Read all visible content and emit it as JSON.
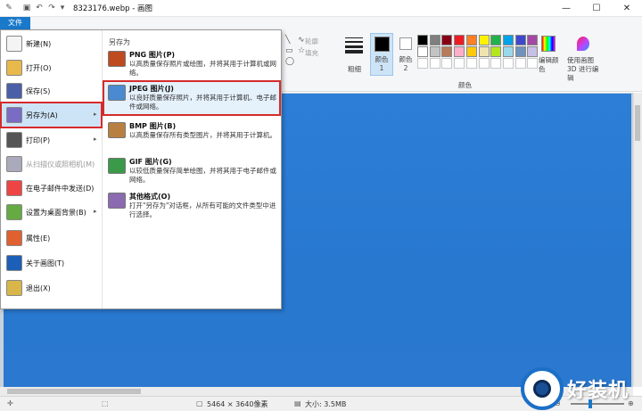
{
  "window": {
    "title": "8323176.webp - 画图",
    "controls": {
      "minimize": "—",
      "maximize": "☐",
      "close": "✕"
    }
  },
  "quick_access": [
    "save-icon",
    "undo-icon",
    "redo-icon",
    "customize-icon"
  ],
  "ribbon": {
    "file_tab": "文件",
    "shapes": {
      "outline": "轮廓",
      "fill": "填充"
    },
    "size_label": "粗细",
    "color1_label": "颜色 1",
    "color2_label": "颜色 2",
    "colors_group": "颜色",
    "edit_colors": "编辑颜色",
    "paint3d": "使用画图 3D 进行编辑",
    "palette_row1": [
      "#000000",
      "#7f7f7f",
      "#880015",
      "#ed1c24",
      "#ff7f27",
      "#fff200",
      "#22b14c",
      "#00a2e8",
      "#3f48cc",
      "#a349a4"
    ],
    "palette_row2": [
      "#ffffff",
      "#c3c3c3",
      "#b97a57",
      "#ffaec9",
      "#ffc90e",
      "#efe4b0",
      "#b5e61d",
      "#99d9ea",
      "#7092be",
      "#c8bfe7"
    ]
  },
  "file_menu": {
    "items": [
      {
        "label": "新建(N)",
        "icon": "new-icon"
      },
      {
        "label": "打开(O)",
        "icon": "open-icon"
      },
      {
        "label": "保存(S)",
        "icon": "save-icon"
      },
      {
        "label": "另存为(A)",
        "icon": "save-as-icon",
        "has_arrow": true,
        "selected": true
      },
      {
        "label": "打印(P)",
        "icon": "print-icon",
        "has_arrow": true
      },
      {
        "label": "从扫描仪或照相机(M)",
        "icon": "scanner-icon",
        "disabled": true
      },
      {
        "label": "在电子邮件中发送(D)",
        "icon": "email-icon"
      },
      {
        "label": "设置为桌面背景(B)",
        "icon": "desktop-icon",
        "has_arrow": true
      },
      {
        "label": "属性(E)",
        "icon": "properties-icon"
      },
      {
        "label": "关于画图(T)",
        "icon": "info-icon"
      },
      {
        "label": "退出(X)",
        "icon": "exit-icon"
      }
    ],
    "submenu_title": "另存为",
    "save_options": [
      {
        "title": "PNG 图片(P)",
        "desc": "以高质量保存照片或绘图，并将其用于计算机或网络。",
        "icon": "png-icon"
      },
      {
        "title": "JPEG 图片(J)",
        "desc": "以良好质量保存照片，并将其用于计算机、电子邮件或网络。",
        "icon": "jpeg-icon",
        "highlight": true
      },
      {
        "title": "BMP 图片(B)",
        "desc": "以高质量保存所有类型图片，并将其用于计算机。",
        "icon": "bmp-icon"
      },
      {
        "title": "GIF 图片(G)",
        "desc": "以较低质量保存简单绘图，并将其用于电子邮件或网络。",
        "icon": "gif-icon"
      },
      {
        "title": "其他格式(O)",
        "desc": "打开\"另存为\"对话框，从所有可能的文件类型中进行选择。",
        "icon": "other-format-icon"
      }
    ]
  },
  "statusbar": {
    "dimensions": "5464 × 3640像素",
    "size": "大小: 3.5MB"
  },
  "watermark": {
    "text": "好装机"
  }
}
